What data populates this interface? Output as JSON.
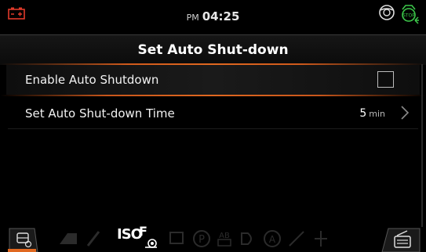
{
  "status": {
    "ampm": "PM",
    "time": "04:25",
    "battery_color": "#e03a2a",
    "stop_color": "#3cc84a"
  },
  "title": "Set Auto Shut-down",
  "rows": [
    {
      "label": "Enable Auto Shutdown",
      "checked": false
    },
    {
      "label": "Set Auto Shut-down Time",
      "value": "5",
      "unit": "min"
    }
  ],
  "bottom": {
    "iso_text": "ISO",
    "f_text": "F"
  },
  "colors": {
    "accent": "#e06820"
  },
  "icons": [
    "battery-warning-icon",
    "steering-warning-icon",
    "engine-stop-icon",
    "auto-settings-icon",
    "chevron-right-icon",
    "radio-icon",
    "snail-icon"
  ]
}
